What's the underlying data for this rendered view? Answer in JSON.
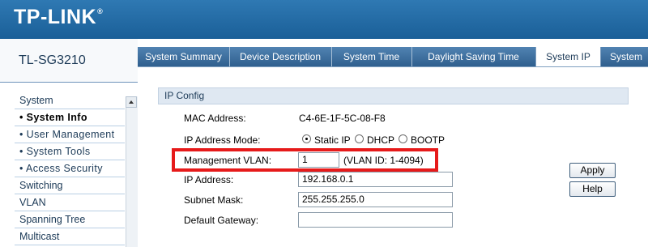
{
  "header": {
    "brand": "TP-LINK",
    "trademark": "®"
  },
  "model": "TL-SG3210",
  "tabs": [
    {
      "label": "System Summary",
      "active": false
    },
    {
      "label": "Device Description",
      "active": false
    },
    {
      "label": "System Time",
      "active": false
    },
    {
      "label": "Daylight Saving Time",
      "active": false
    },
    {
      "label": "System IP",
      "active": true
    },
    {
      "label": "System",
      "active": false
    }
  ],
  "sidebar": {
    "items": [
      {
        "label": "System",
        "sub": false,
        "active": false
      },
      {
        "label": "• System Info",
        "sub": true,
        "active": true
      },
      {
        "label": "• User Management",
        "sub": true,
        "active": false
      },
      {
        "label": "• System Tools",
        "sub": true,
        "active": false
      },
      {
        "label": "• Access Security",
        "sub": true,
        "active": false
      },
      {
        "label": "Switching",
        "sub": false,
        "active": false
      },
      {
        "label": "VLAN",
        "sub": false,
        "active": false
      },
      {
        "label": "Spanning Tree",
        "sub": false,
        "active": false
      },
      {
        "label": "Multicast",
        "sub": false,
        "active": false
      }
    ]
  },
  "ip_config": {
    "title": "IP Config",
    "mac_label": "MAC Address:",
    "mac_value": "C4-6E-1F-5C-08-F8",
    "mode_label": "IP Address Mode:",
    "mode_options": [
      "Static IP",
      "DHCP",
      "BOOTP"
    ],
    "mode_selected": "Static IP",
    "vlan_label": "Management VLAN:",
    "vlan_value": "1",
    "vlan_hint": "(VLAN ID: 1-4094)",
    "ip_label": "IP Address:",
    "ip_value": "192.168.0.1",
    "mask_label": "Subnet Mask:",
    "mask_value": "255.255.255.0",
    "gateway_label": "Default Gateway:",
    "gateway_value": ""
  },
  "buttons": {
    "apply": "Apply",
    "help": "Help"
  },
  "colors": {
    "header_blue": "#1a5f98",
    "highlight_red": "#e61a1a",
    "tab_blue": "#2f5f8e"
  }
}
